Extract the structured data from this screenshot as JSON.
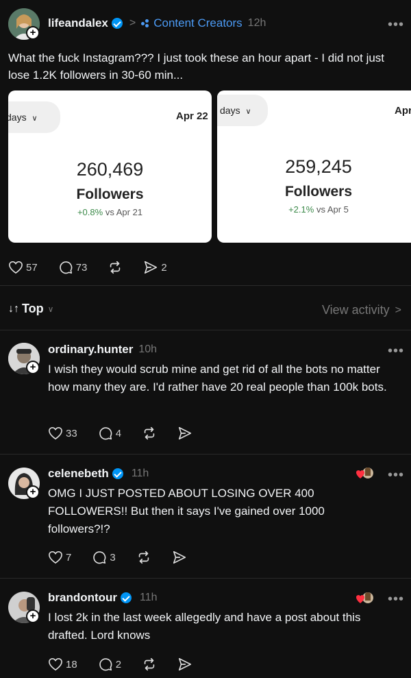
{
  "post": {
    "username": "lifeandalex",
    "community": "Content Creators",
    "time": "12h",
    "text": "What the fuck Instagram??? I just took these an hour apart - I did not just lose 1.2K followers in 30-60 min...",
    "images": [
      {
        "range_label": "days",
        "date_label": "Apr 22",
        "followers_count": "260,469",
        "followers_label": "Followers",
        "change": "+0.8%",
        "comparison": "vs Apr 21"
      },
      {
        "range_label": "days",
        "date_label": "Apr",
        "followers_count": "259,245",
        "followers_label": "Followers",
        "change": "+2.1%",
        "comparison": "vs Apr 5"
      }
    ],
    "likes": "57",
    "replies": "73",
    "shares": "2"
  },
  "sort": {
    "label": "Top",
    "view_activity": "View activity"
  },
  "comments": [
    {
      "username": "ordinary.hunter",
      "time": "10h",
      "verified": false,
      "text": "I wish they would scrub mine and get rid of all the bots no matter how many they are. I'd rather have 20 real people than 100k bots.",
      "likes": "33",
      "replies": "4"
    },
    {
      "username": "celenebeth",
      "time": "11h",
      "verified": true,
      "text": "OMG I JUST POSTED ABOUT LOSING OVER 400 FOLLOWERS!! But then it says I've gained over 1000 followers?!?",
      "likes": "7",
      "replies": "3"
    },
    {
      "username": "brandontour",
      "time": "11h",
      "verified": true,
      "text": "I lost 2k in the last week allegedly and have a post about this drafted. Lord knows",
      "likes": "18",
      "replies": "2"
    }
  ],
  "colors": {
    "background": "#101010",
    "link": "#4c9bf5",
    "verified": "#0095f6",
    "positive": "#3c8a4a",
    "reaction_heart": "#ff3040"
  }
}
